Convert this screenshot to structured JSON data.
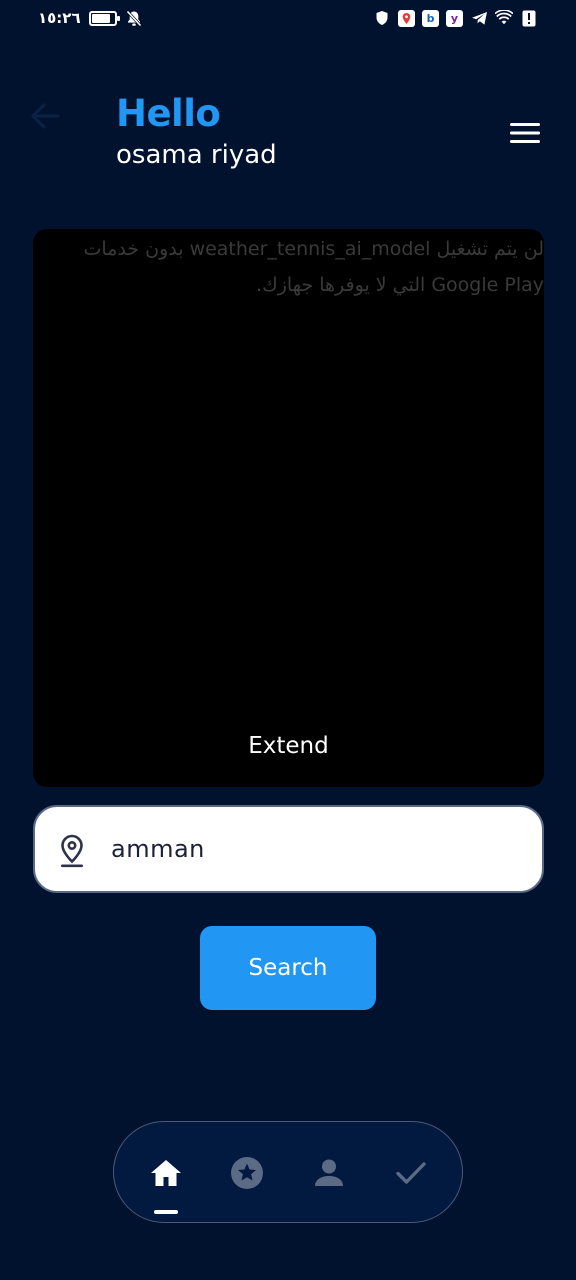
{
  "status_bar": {
    "time": "١٥:٢٦",
    "battery_level": 0.85,
    "app_badges": [
      "b",
      "y"
    ]
  },
  "header": {
    "greeting": "Hello",
    "username": "osama riyad",
    "back_icon": "arrow-left-icon",
    "menu_icon": "hamburger-menu-icon"
  },
  "ad_panel": {
    "message_line1": "لن يتم تشغيل weather_tennis_ai_model بدون خدمات",
    "message_line2": "Google Play التي لا يوفرها جهازك.",
    "extend_label": "Extend"
  },
  "search": {
    "icon": "location-pin-icon",
    "value": "amman",
    "button_label": "Search"
  },
  "bottom_nav": {
    "items": [
      {
        "icon": "home-icon",
        "active": true
      },
      {
        "icon": "star-circle-icon",
        "active": false
      },
      {
        "icon": "person-icon",
        "active": false
      },
      {
        "icon": "check-icon",
        "active": false
      }
    ]
  },
  "colors": {
    "background": "#01122f",
    "accent": "#2196f3",
    "nav_background": "#021a3f",
    "inactive_icon": "#5b6b85"
  }
}
